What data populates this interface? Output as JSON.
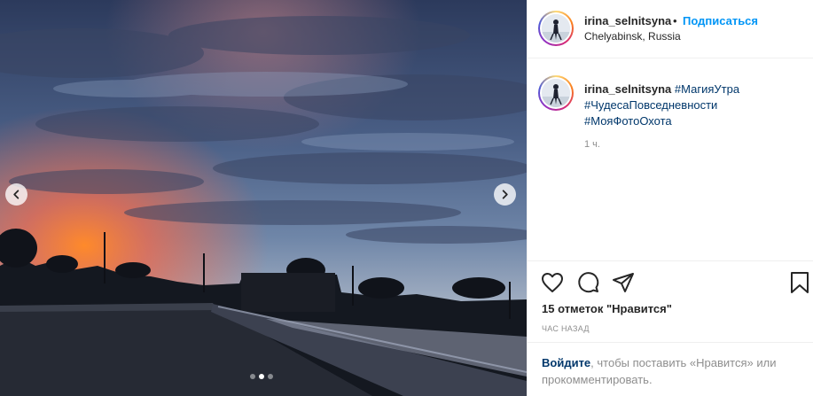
{
  "post": {
    "username": "irina_selnitsyna",
    "separator": "•",
    "follow_label": "Подписаться",
    "location": "Chelyabinsk, Russia"
  },
  "caption": {
    "username": "irina_selnitsyna",
    "hashtags": [
      "#МагияУтра",
      "#ЧудесаПовседневности",
      "#МояФотоОхота"
    ],
    "time": "1 ч."
  },
  "actions": {
    "icons": [
      "heart-icon",
      "comment-bubble-icon",
      "paper-plane-icon",
      "bookmark-icon"
    ]
  },
  "likes_text": "15 отметок \"Нравится\"",
  "timestamp_text": "ЧАС НАЗАД",
  "login_prompt": {
    "link": "Войдите",
    "text": ", чтобы поставить «Нравится» или прокомментировать."
  },
  "carousel": {
    "slide_count": 3,
    "active_index": 1
  },
  "colors": {
    "accent_blue": "#0095f6",
    "tag_blue": "#00376b",
    "muted_gray": "#8e8e8e",
    "text_dark": "#262626"
  }
}
